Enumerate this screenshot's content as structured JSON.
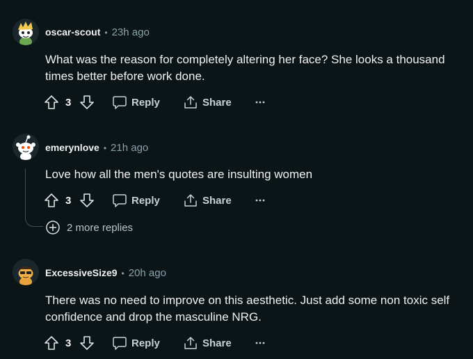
{
  "comments": [
    {
      "author": "oscar-scout",
      "time": "23h ago",
      "body": "What was the reason for completely altering her face? She looks a thousand times better before work done.",
      "votes": "3",
      "reply_label": "Reply",
      "share_label": "Share",
      "avatar_icon": "snoo-avatar-blonde-icon"
    },
    {
      "author": "emerynlove",
      "time": "21h ago",
      "body": "Love how all the men's quotes are insulting women",
      "votes": "3",
      "reply_label": "Reply",
      "share_label": "Share",
      "more_replies": "2 more replies",
      "avatar_icon": "snoo-avatar-default-icon"
    },
    {
      "author": "ExcessiveSize9",
      "time": "20h ago",
      "body": "There was no need to improve on this aesthetic. Just add some non toxic self confidence and drop the masculine NRG.",
      "votes": "3",
      "reply_label": "Reply",
      "share_label": "Share",
      "avatar_icon": "snoo-avatar-orange-icon"
    }
  ],
  "colors": {
    "background": "#0b1416",
    "text": "#f2f2f2",
    "muted": "#8ba2ad",
    "action": "#c5d3d9"
  }
}
